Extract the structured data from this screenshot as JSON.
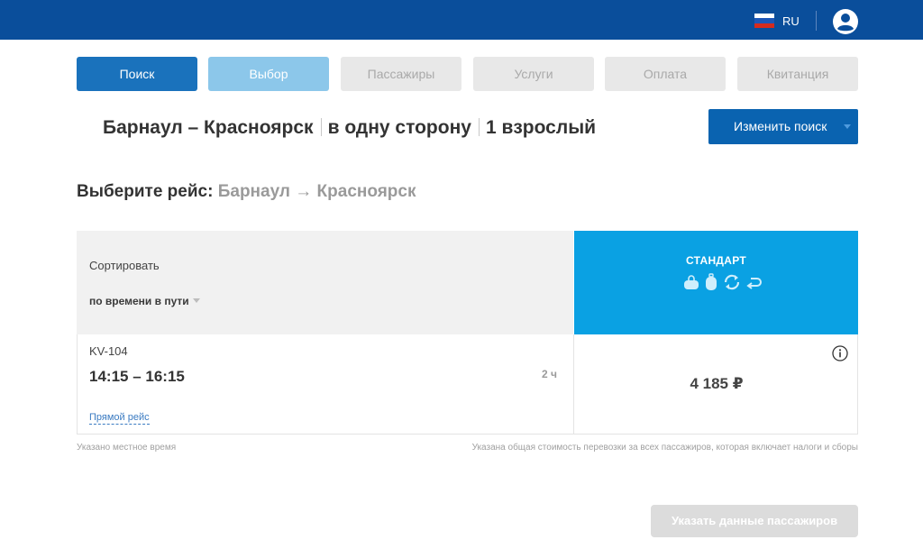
{
  "header": {
    "language": "RU",
    "flag_colors": [
      "#ffffff",
      "#1c56b8",
      "#d52b1e"
    ]
  },
  "steps": [
    {
      "label": "Поиск",
      "state": "active"
    },
    {
      "label": "Выбор",
      "state": "current"
    },
    {
      "label": "Пассажиры",
      "state": "disabled"
    },
    {
      "label": "Услуги",
      "state": "disabled"
    },
    {
      "label": "Оплата",
      "state": "disabled"
    },
    {
      "label": "Квитанция",
      "state": "disabled"
    }
  ],
  "search_summary": {
    "route": "Барнаул – Красноярск",
    "trip_type": "в одну сторону",
    "passengers": "1 взрослый",
    "change_button": "Изменить поиск"
  },
  "choose": {
    "label": "Выберите рейс:",
    "from": "Барнаул",
    "arrow": "→",
    "to": "Красноярск"
  },
  "sort": {
    "label": "Сортировать",
    "value": "по времени в пути"
  },
  "fare": {
    "name": "СТАНДАРТ",
    "icons": [
      "hand-bag-icon",
      "luggage-icon",
      "exchange-icon",
      "refund-icon"
    ],
    "color": "#0aa1e3"
  },
  "flight": {
    "number": "KV-104",
    "times": "14:15 – 16:15",
    "duration": "2 ч",
    "direct_label": "Прямой рейс",
    "price": "4 185 ₽"
  },
  "notes": {
    "local_time": "Указано местное время",
    "total_price": "Указана общая стоимость перевозки за всех пассажиров, которая включает налоги и сборы"
  },
  "continue_button": "Указать данные пассажиров",
  "colors": {
    "topbar": "#0a4e9b",
    "primary": "#1a72bc",
    "secondary": "#8cc7ea"
  }
}
